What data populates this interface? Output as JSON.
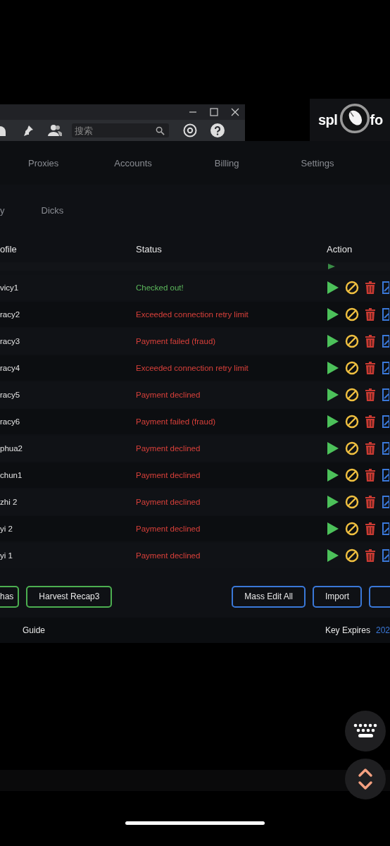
{
  "browser": {
    "search": {
      "placeholder": "搜索"
    }
  },
  "logo": {
    "left": "spl",
    "right": "fo"
  },
  "nav": [
    {
      "label": "Proxies",
      "selected": false
    },
    {
      "label": "Accounts",
      "selected": false
    },
    {
      "label": "Billing",
      "selected": false
    },
    {
      "label": "Settings",
      "selected": false
    }
  ],
  "subtabs": [
    {
      "label": "y",
      "selected": false
    },
    {
      "label": "Dicks",
      "selected": false
    }
  ],
  "table": {
    "columns": [
      "ofile",
      "Status",
      "Action"
    ],
    "rows": [
      {
        "profile": "vicy1",
        "status": "Checked out!",
        "kind": "success"
      },
      {
        "profile": "racy2",
        "status": "Exceeded connection retry limit",
        "kind": "error"
      },
      {
        "profile": "racy3",
        "status": "Payment failed (fraud)",
        "kind": "error"
      },
      {
        "profile": "racy4",
        "status": "Exceeded connection retry limit",
        "kind": "error"
      },
      {
        "profile": "racy5",
        "status": "Payment declined",
        "kind": "error"
      },
      {
        "profile": "racy6",
        "status": "Payment failed (fraud)",
        "kind": "error"
      },
      {
        "profile": "phua2",
        "status": "Payment declined",
        "kind": "error"
      },
      {
        "profile": "chun1",
        "status": "Payment declined",
        "kind": "error"
      },
      {
        "profile": "zhi 2",
        "status": "Payment declined",
        "kind": "error"
      },
      {
        "profile": "yi 2",
        "status": "Payment declined",
        "kind": "error"
      },
      {
        "profile": "yi 1",
        "status": "Payment declined",
        "kind": "error"
      }
    ]
  },
  "left_buttons": [
    {
      "label": "has",
      "color": "#4caf50"
    },
    {
      "label": "Harvest Recap3",
      "color": "#4caf50"
    }
  ],
  "right_buttons": [
    {
      "label": "Mass Edit All",
      "color": "#3a78d8"
    },
    {
      "label": "Import",
      "color": "#3a78d8"
    },
    {
      "color": "#3a78d8"
    }
  ],
  "footer": {
    "guide": "Guide",
    "key_label": "Key Expires",
    "key_value": "202"
  }
}
